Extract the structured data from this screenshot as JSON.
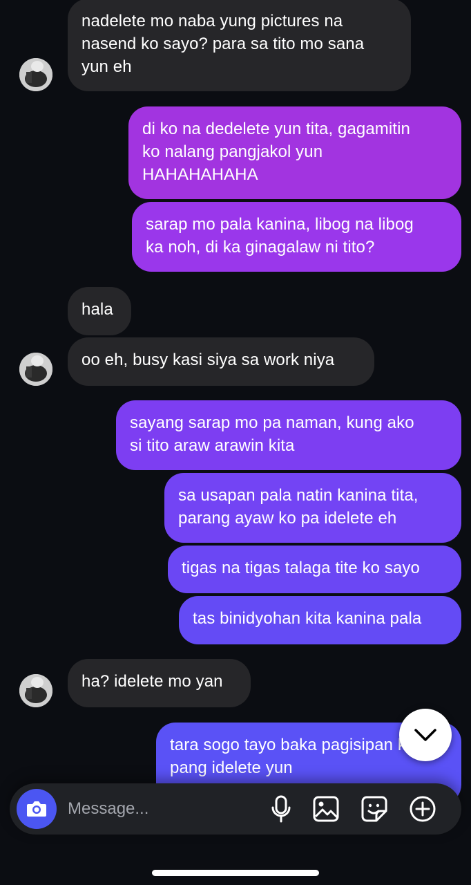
{
  "messages": [
    {
      "side": "in",
      "text": "nadelete mo naba yung pictures na\nnasend ko sayo? para sa tito mo sana\nyun eh"
    },
    {
      "side": "out",
      "text": "di ko na dedelete yun tita, gagamitin\nko nalang pangjakol yun\nHAHAHAHAHA",
      "color": "#a234e0"
    },
    {
      "side": "out",
      "text": "sarap mo pala kanina, libog na libog\nka noh, di ka ginagalaw ni tito?",
      "color": "#9a37eb"
    },
    {
      "side": "in",
      "text": "hala"
    },
    {
      "side": "in",
      "text": "oo eh, busy kasi siya sa work niya"
    },
    {
      "side": "out",
      "text": "sayang sarap mo pa naman, kung ako\nsi tito araw arawin kita",
      "color": "#7d3ef2"
    },
    {
      "side": "out",
      "text": "sa usapan pala natin kanina tita,\nparang ayaw ko pa idelete eh",
      "color": "#7344f4"
    },
    {
      "side": "out",
      "text": "tigas na tigas talaga tite ko sayo",
      "color": "#6b47f4"
    },
    {
      "side": "out",
      "text": "tas binidyohan kita kanina pala",
      "color": "#644bf5"
    },
    {
      "side": "in",
      "text": "ha? idelete mo yan"
    },
    {
      "side": "out",
      "text": "tara sogo tayo baka pagisipan ko pa\npang idelete yun",
      "color": "#5a52f6"
    }
  ],
  "composer": {
    "placeholder": "Message...",
    "icons": [
      "camera-icon",
      "microphone-icon",
      "gallery-icon",
      "sticker-icon",
      "plus-icon"
    ]
  },
  "scroll_button": {
    "icon": "chevron-down-icon"
  }
}
